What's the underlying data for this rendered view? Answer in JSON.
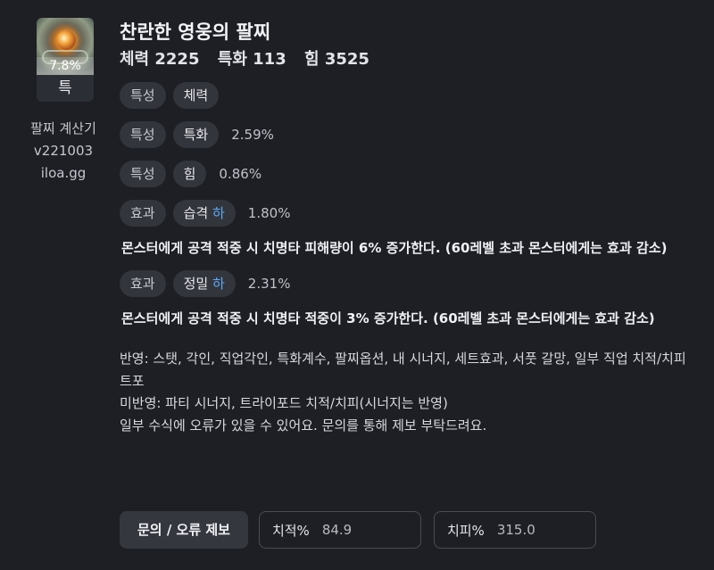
{
  "item": {
    "percent": "7.8%",
    "grade": "특",
    "name": "찬란한 영웅의 팔찌",
    "stats": [
      "체력 2225",
      "특화 113",
      "힘 3525"
    ]
  },
  "calculator": {
    "name": "팔찌 계산기",
    "version": "v221003",
    "site": "iloa.gg"
  },
  "options": [
    {
      "type": "특성",
      "name": "체력",
      "level": "",
      "percent": "",
      "description": ""
    },
    {
      "type": "특성",
      "name": "특화",
      "level": "",
      "percent": "2.59%",
      "description": ""
    },
    {
      "type": "특성",
      "name": "힘",
      "level": "",
      "percent": "0.86%",
      "description": ""
    },
    {
      "type": "효과",
      "name": "습격 ",
      "level": "하",
      "percent": "1.80%",
      "description": "몬스터에게 공격 적중 시 치명타 피해량이 6% 증가한다. (60레벨 초과 몬스터에게는 효과 감소)"
    },
    {
      "type": "효과",
      "name": "정밀 ",
      "level": "하",
      "percent": "2.31%",
      "description": "몬스터에게 공격 적중 시 치명타 적중이 3% 증가한다. (60레벨 초과 몬스터에게는 효과 감소)"
    }
  ],
  "notes": {
    "applied": "반영: 스탯, 각인, 직업각인, 특화계수, 팔찌옵션, 내 시너지, 세트효과, 서풋 갈망, 일부 직업 치적/치피 트포",
    "not_applied": "미반영: 파티 시너지, 트라이포드 치적/치피(시너지는 반영)",
    "disclaimer": "일부 수식에 오류가 있을 수 있어요. 문의를 통해 제보 부탁드려요."
  },
  "bottom": {
    "report_button": "문의 / 오류 제보",
    "crit_rate_label": "치적%",
    "crit_rate_value": "84.9",
    "crit_dmg_label": "치피%",
    "crit_dmg_value": "315.0"
  },
  "colors": {
    "background": "#1e1f24",
    "chip": "#33353c",
    "level_accent": "#5fa8f5"
  }
}
